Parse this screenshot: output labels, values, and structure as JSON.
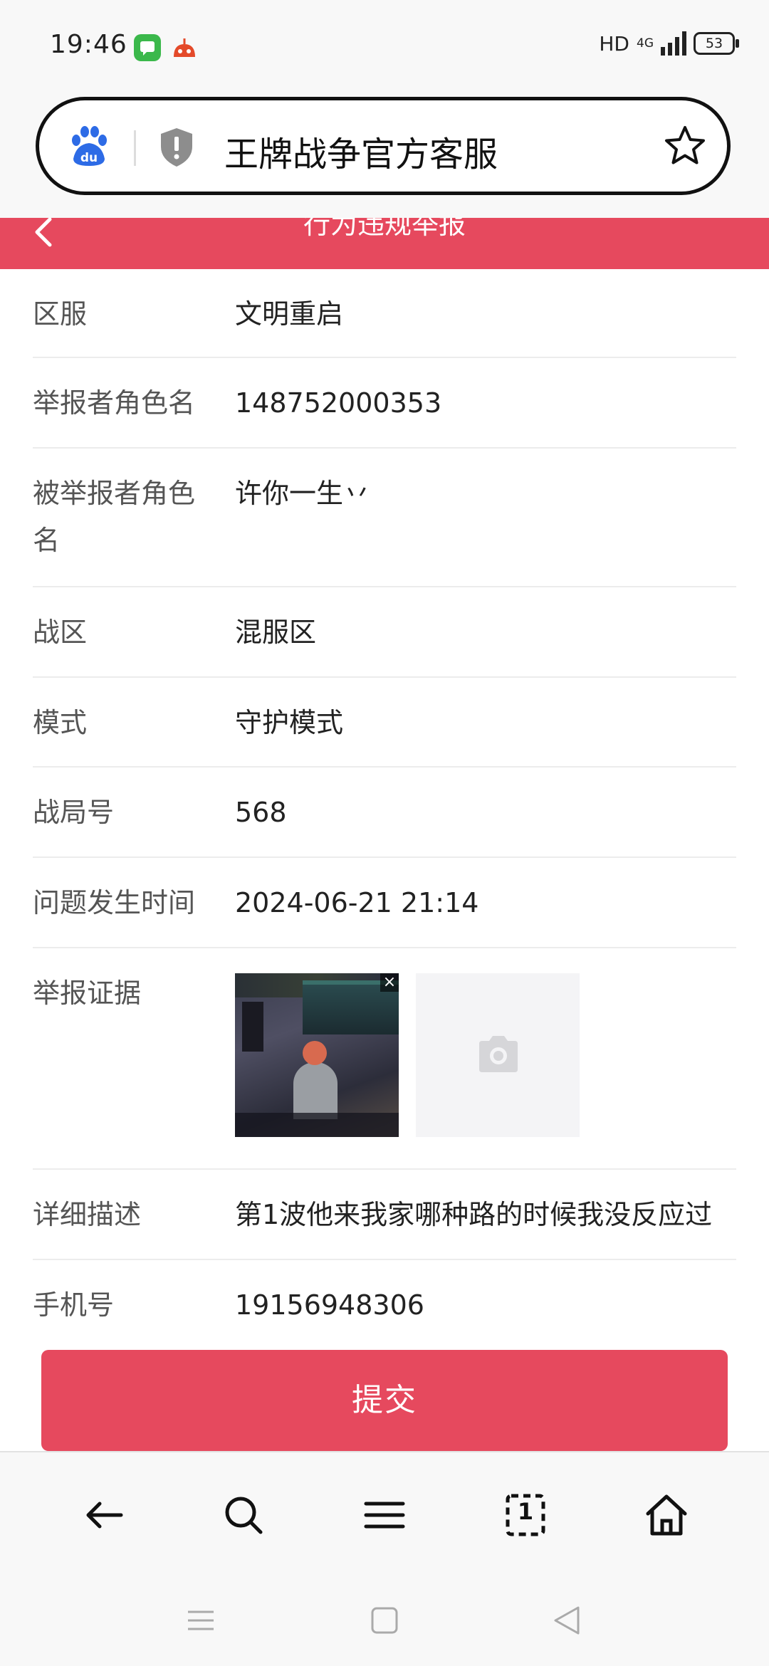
{
  "status_bar": {
    "time": "19:46",
    "hd": "HD",
    "network": "4G",
    "battery": "53"
  },
  "address_bar": {
    "title": "王牌战争官方客服"
  },
  "header": {
    "title": "行为违规举报"
  },
  "form": {
    "rows": [
      {
        "label": "区服",
        "value": "文明重启"
      },
      {
        "label": "举报者角色名",
        "value": "148752000353"
      },
      {
        "label": "被举报者角色名",
        "value": "许你一生丷"
      },
      {
        "label": "战区",
        "value": "混服区"
      },
      {
        "label": "模式",
        "value": "守护模式"
      },
      {
        "label": "战局号",
        "value": "568"
      },
      {
        "label": "问题发生时间",
        "value": "2024-06-21 21:14"
      },
      {
        "label": "举报证据",
        "value": ""
      },
      {
        "label": "详细描述",
        "value": "第1波他来我家哪种路的时候我没反应过"
      },
      {
        "label": "手机号",
        "value": "19156948306"
      }
    ],
    "evidence_close": "×"
  },
  "submit": {
    "label": "提交"
  },
  "colors": {
    "accent": "#e6495e",
    "baidu_blue": "#2d6be6"
  },
  "toolbar": {
    "items": [
      "back-arrow-icon",
      "search-icon",
      "menu-icon",
      "tabs-icon",
      "home-icon"
    ],
    "tab_count": "1"
  }
}
